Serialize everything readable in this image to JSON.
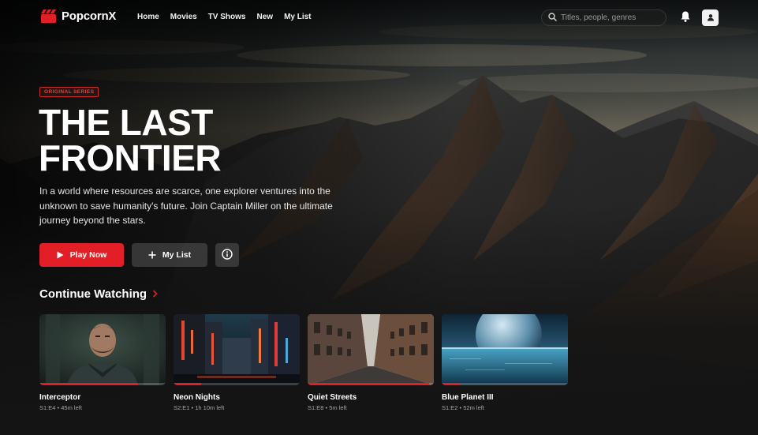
{
  "brand": {
    "name": "PopcornX",
    "logo_icon": "clapperboard-icon",
    "accent": "#e21f26"
  },
  "nav": {
    "links": [
      "Home",
      "Movies",
      "TV Shows",
      "New",
      "My List"
    ],
    "search_placeholder": "Titles, people, genres",
    "search_icon": "search-icon",
    "bell_icon": "bell-icon",
    "avatar_icon": "user-icon"
  },
  "hero": {
    "badge": "ORIGINAL SERIES",
    "title_line1": "THE LAST",
    "title_line2": "FRONTIER",
    "description": "In a world where resources are scarce, one explorer ventures into the unknown to save humanity's future. Join Captain Miller on the ultimate journey beyond the stars.",
    "play_label": "Play Now",
    "play_icon": "play-icon",
    "list_label": "My List",
    "list_icon": "plus-icon",
    "info_icon": "info-icon"
  },
  "continue_watching": {
    "title": "Continue Watching",
    "chevron_icon": "chevron-right-icon",
    "items": [
      {
        "title": "Interceptor",
        "meta": "S1:E4 • 45m left",
        "progress": 0.78
      },
      {
        "title": "Neon Nights",
        "meta": "S2:E1 • 1h 10m left",
        "progress": 0.22
      },
      {
        "title": "Quiet Streets",
        "meta": "S1:E8 • 5m left",
        "progress": 0.96
      },
      {
        "title": "Blue Planet III",
        "meta": "S1:E2 • 52m left",
        "progress": 0.15
      }
    ]
  }
}
